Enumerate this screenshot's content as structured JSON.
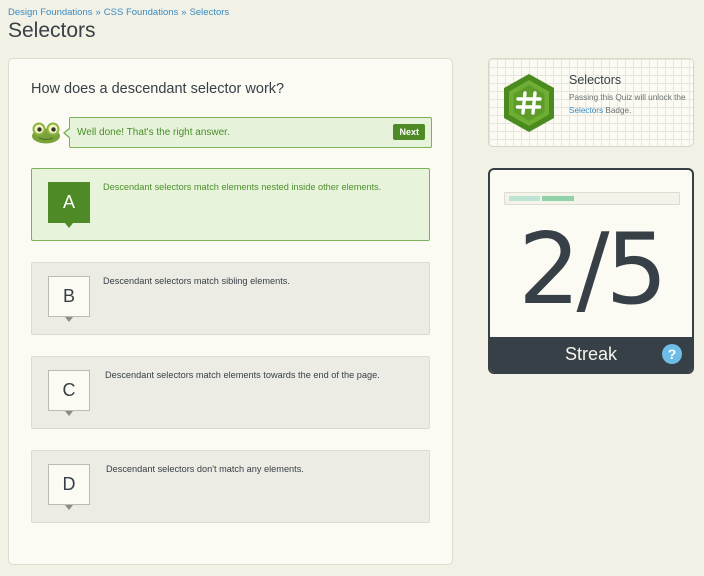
{
  "breadcrumb": {
    "items": [
      "Design Foundations",
      "CSS Foundations",
      "Selectors"
    ],
    "separator": "»"
  },
  "page_title": "Selectors",
  "quiz": {
    "question": "How does a descendant selector work?",
    "feedback": {
      "message": "Well done! That's the right answer.",
      "next_label": "Next"
    },
    "answers": [
      {
        "letter": "A",
        "text": "Descendant selectors match elements nested inside other elements.",
        "state": "correct"
      },
      {
        "letter": "B",
        "text": "Descendant selectors match sibling elements.",
        "state": "default"
      },
      {
        "letter": "C",
        "text": "Descendant selectors match elements towards the end of the page.",
        "state": "default"
      },
      {
        "letter": "D",
        "text": "Descendant selectors don't match any elements.",
        "state": "default"
      }
    ]
  },
  "badge": {
    "title": "Selectors",
    "desc_prefix": "Passing this Quiz will unlock the",
    "desc_link": "Selectors",
    "desc_suffix": "Badge.",
    "icon": "hash-icon",
    "color": "#5a9a2a"
  },
  "streak": {
    "value": "2/5",
    "label": "Streak",
    "help": "?",
    "progress_done": 2,
    "progress_total": 5
  },
  "colors": {
    "background": "#f2f1e6",
    "link": "#3b8bc1",
    "correct_green": "#4e8a25",
    "dark": "#384047"
  }
}
